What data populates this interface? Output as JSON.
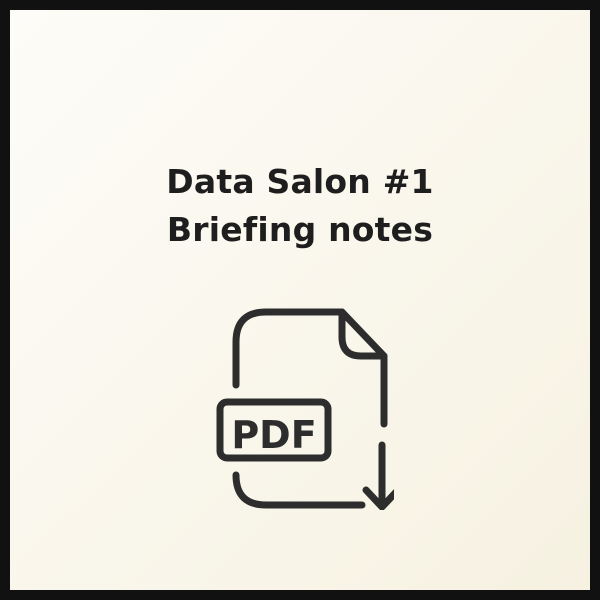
{
  "card": {
    "title_line1": "Data Salon #1",
    "title_line2": "Briefing notes",
    "background_color": "#f8f4e8",
    "border_color": "#111111",
    "text_color": "#1e1e1e"
  },
  "icon": {
    "name": "pdf-download-icon",
    "label": "PDF",
    "stroke_color": "#2d2d2d"
  }
}
